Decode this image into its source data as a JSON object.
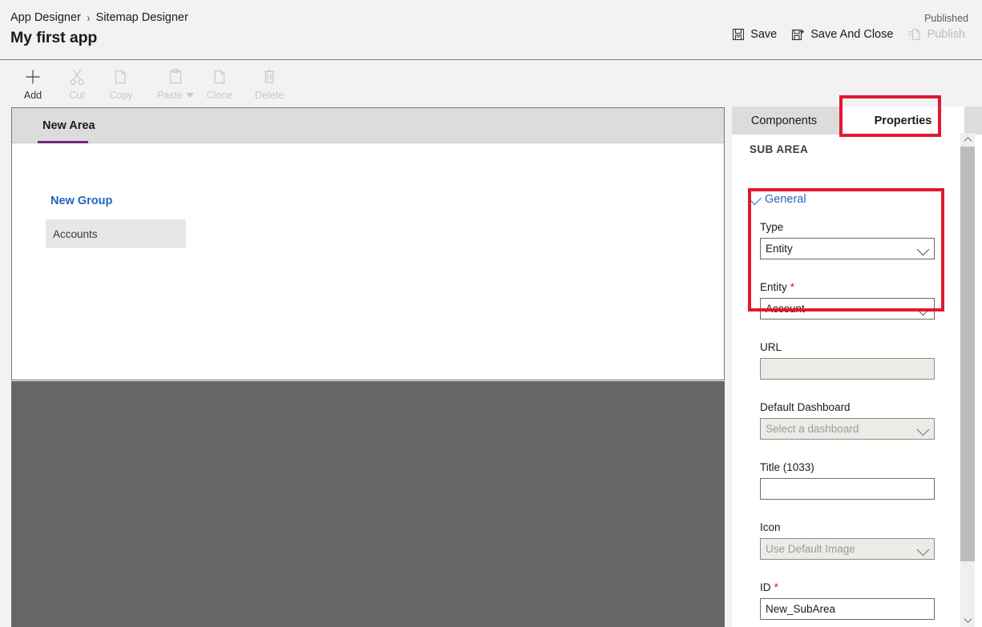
{
  "header": {
    "breadcrumb": [
      {
        "label": "App Designer"
      },
      {
        "label": "Sitemap Designer"
      }
    ],
    "breadcrumb_separator": "›",
    "app_title": "My first app",
    "published_status": "Published",
    "actions": [
      {
        "label": "Save",
        "icon": "save-icon",
        "enabled": true
      },
      {
        "label": "Save And Close",
        "icon": "save-and-close-icon",
        "enabled": true
      },
      {
        "label": "Publish",
        "icon": "publish-icon",
        "enabled": false
      }
    ]
  },
  "ribbon": {
    "commands": [
      {
        "label": "Add",
        "icon": "plus-icon",
        "enabled": true,
        "has_dropdown": false
      },
      {
        "label": "Cut",
        "icon": "scissors-icon",
        "enabled": false,
        "has_dropdown": false
      },
      {
        "label": "Copy",
        "icon": "copy-icon",
        "enabled": false,
        "has_dropdown": false
      },
      {
        "label": "Paste",
        "icon": "clipboard-icon",
        "enabled": false,
        "has_dropdown": true
      },
      {
        "label": "Clone",
        "icon": "clone-icon",
        "enabled": false,
        "has_dropdown": false
      },
      {
        "label": "Delete",
        "icon": "trash-icon",
        "enabled": false,
        "has_dropdown": false
      }
    ]
  },
  "canvas": {
    "area_tab": "New Area",
    "group_title": "New Group",
    "subarea_item": "Accounts"
  },
  "panel": {
    "tabs": [
      {
        "label": "Components",
        "active": false
      },
      {
        "label": "Properties",
        "active": true
      }
    ],
    "section_header": "SUB AREA",
    "group_label": "General",
    "fields": {
      "type": {
        "label": "Type",
        "value": "Entity",
        "control": "dropdown",
        "required": false,
        "enabled": true
      },
      "entity": {
        "label": "Entity",
        "value": "Account",
        "control": "dropdown",
        "required": true,
        "enabled": true
      },
      "url": {
        "label": "URL",
        "value": "",
        "placeholder": "",
        "control": "text",
        "required": false,
        "enabled": false
      },
      "default_dashboard": {
        "label": "Default Dashboard",
        "value": "Select a dashboard",
        "control": "dropdown",
        "required": false,
        "enabled": false
      },
      "title": {
        "label": "Title (1033)",
        "value": "",
        "placeholder": "",
        "control": "text",
        "required": false,
        "enabled": true
      },
      "icon": {
        "label": "Icon",
        "value": "Use Default Image",
        "control": "dropdown",
        "required": false,
        "enabled": false
      },
      "id": {
        "label": "ID",
        "value": "New_SubArea",
        "control": "text",
        "required": true,
        "enabled": true
      }
    },
    "required_marker": "*"
  },
  "colors": {
    "accent_purple": "#76277d",
    "link_blue": "#2266bb",
    "annotation_red": "#e01931",
    "required_red": "#e81123",
    "overlay_gray": "#666666",
    "tabbar_gray": "#dcdcdc",
    "selected_item_gray": "#e7e7e7",
    "disabled_field": "#ecebe5",
    "page_background": "#f2f2f2"
  },
  "annotations": [
    {
      "name": "properties-tab-highlight",
      "target": "Properties tab"
    },
    {
      "name": "type-entity-highlight",
      "target": "Type and Entity fields"
    }
  ]
}
